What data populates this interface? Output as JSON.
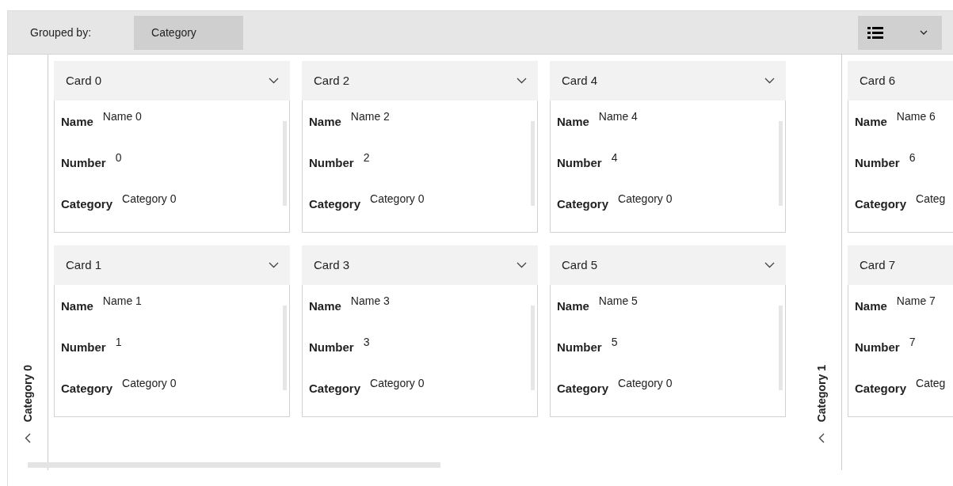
{
  "toolbar": {
    "grouped_by_label": "Grouped by:",
    "grouped_by_value": "Category"
  },
  "groups": [
    {
      "header": "Category 0",
      "columns": [
        [
          {
            "title": "Card 0",
            "chevron": true,
            "fields": [
              {
                "label": "Name",
                "value": "Name 0"
              },
              {
                "label": "Number",
                "value": "0"
              },
              {
                "label": "Category",
                "value": "Category 0"
              }
            ]
          },
          {
            "title": "Card 1",
            "chevron": true,
            "fields": [
              {
                "label": "Name",
                "value": "Name 1"
              },
              {
                "label": "Number",
                "value": "1"
              },
              {
                "label": "Category",
                "value": "Category 0"
              }
            ]
          }
        ],
        [
          {
            "title": "Card 2",
            "chevron": true,
            "fields": [
              {
                "label": "Name",
                "value": "Name 2"
              },
              {
                "label": "Number",
                "value": "2"
              },
              {
                "label": "Category",
                "value": "Category 0"
              }
            ]
          },
          {
            "title": "Card 3",
            "chevron": true,
            "fields": [
              {
                "label": "Name",
                "value": "Name 3"
              },
              {
                "label": "Number",
                "value": "3"
              },
              {
                "label": "Category",
                "value": "Category 0"
              }
            ]
          }
        ],
        [
          {
            "title": "Card 4",
            "chevron": true,
            "fields": [
              {
                "label": "Name",
                "value": "Name 4"
              },
              {
                "label": "Number",
                "value": "4"
              },
              {
                "label": "Category",
                "value": "Category 0"
              }
            ]
          },
          {
            "title": "Card 5",
            "chevron": true,
            "fields": [
              {
                "label": "Name",
                "value": "Name 5"
              },
              {
                "label": "Number",
                "value": "5"
              },
              {
                "label": "Category",
                "value": "Category 0"
              }
            ]
          }
        ]
      ]
    },
    {
      "header": "Category 1",
      "columns": [
        [
          {
            "title": "Card 6",
            "chevron": false,
            "fields": [
              {
                "label": "Name",
                "value": "Name 6"
              },
              {
                "label": "Number",
                "value": "6"
              },
              {
                "label": "Category",
                "value": "Categ"
              }
            ]
          },
          {
            "title": "Card 7",
            "chevron": false,
            "fields": [
              {
                "label": "Name",
                "value": "Name 7"
              },
              {
                "label": "Number",
                "value": "7"
              },
              {
                "label": "Category",
                "value": "Categ"
              }
            ]
          }
        ]
      ]
    }
  ]
}
